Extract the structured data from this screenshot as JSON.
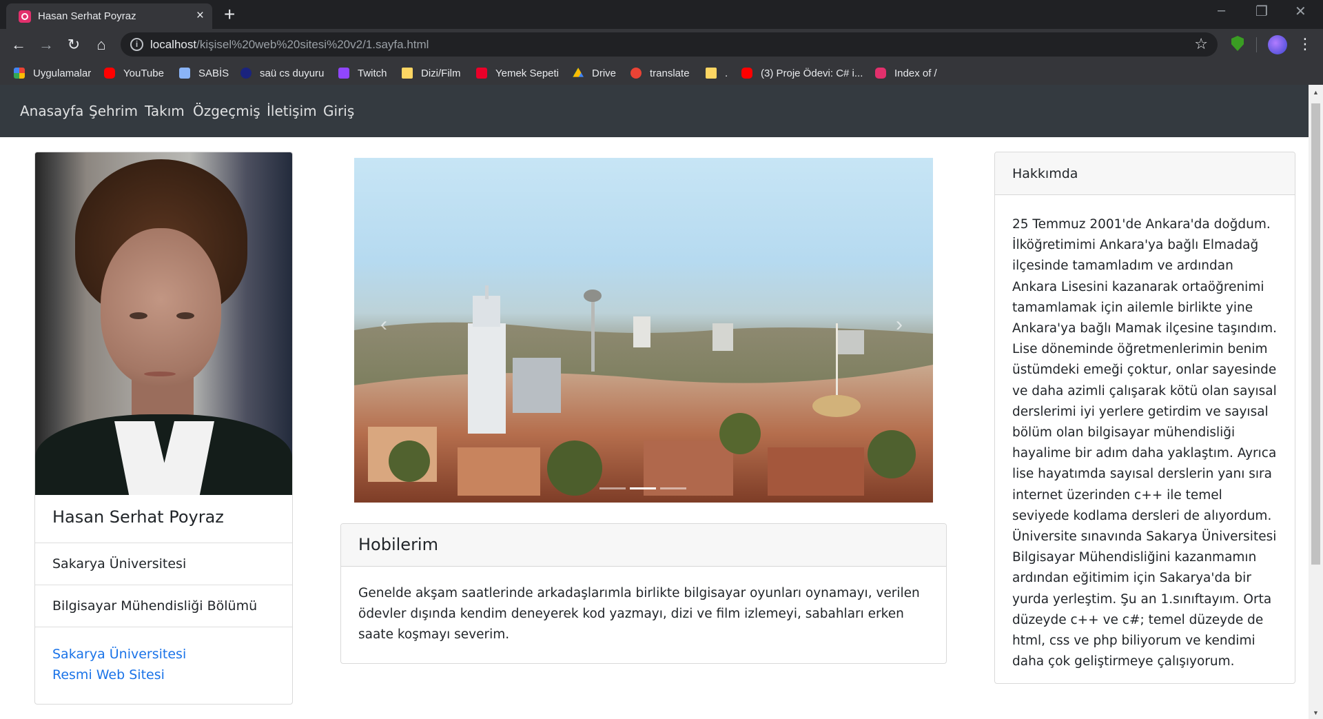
{
  "browser": {
    "tab_title": "Hasan Serhat Poyraz",
    "tab_close": "×",
    "new_tab": "+",
    "url_host": "localhost",
    "url_path": "/kişisel%20web%20sitesi%20v2/1.sayfa.html",
    "window_controls": [
      "–",
      "❐",
      "✕"
    ],
    "icons": [
      "back-icon",
      "forward-icon",
      "reload-icon",
      "home-icon",
      "info-icon",
      "star-icon",
      "shield-extension-icon",
      "profile-avatar",
      "menu-icon"
    ]
  },
  "bookmarks": [
    {
      "label": "Uygulamalar",
      "icon": "apps-icon"
    },
    {
      "label": "YouTube",
      "icon": "youtube-icon"
    },
    {
      "label": "SABİS",
      "icon": "document-icon"
    },
    {
      "label": "saü cs duyuru",
      "icon": "site-icon"
    },
    {
      "label": "Twitch",
      "icon": "twitch-icon"
    },
    {
      "label": "Dizi/Film",
      "icon": "folder-icon"
    },
    {
      "label": "Yemek Sepeti",
      "icon": "yemeksepeti-icon"
    },
    {
      "label": "Drive",
      "icon": "drive-icon"
    },
    {
      "label": "translate",
      "icon": "translate-icon"
    },
    {
      "label": ".",
      "icon": "folder-icon"
    },
    {
      "label": "(3) Proje Ödevi: C# i...",
      "icon": "youtube-icon"
    },
    {
      "label": "Index of /",
      "icon": "index-icon"
    }
  ],
  "nav": {
    "items": [
      "Anasayfa",
      "Şehrim",
      "Takım",
      "Özgeçmiş",
      "İletişim",
      "Giriş"
    ]
  },
  "profile": {
    "name": "Hasan Serhat Poyraz",
    "university": "Sakarya Üniversitesi",
    "department": "Bilgisayar Mühendisliği Bölümü",
    "link_line1": "Sakarya Üniversitesi",
    "link_line2": "Resmi Web Sitesi"
  },
  "carousel": {
    "prev": "‹",
    "next": "›",
    "slide_count": 3,
    "active_slide": 2
  },
  "hobbies": {
    "title": "Hobilerim",
    "text": "Genelde akşam saatlerinde arkadaşlarımla birlikte bilgisayar oyunları oynamayı, verilen ödevler dışında kendim deneyerek kod yazmayı, dizi ve film izlemeyi, sabahları erken saate koşmayı severim."
  },
  "about": {
    "title": "Hakkımda",
    "text": "25 Temmuz 2001'de Ankara'da doğdum. İlköğretimimi Ankara'ya bağlı Elmadağ ilçesinde tamamladım ve ardından Ankara Lisesini kazanarak ortaöğrenimi tamamlamak için ailemle birlikte yine Ankara'ya bağlı Mamak ilçesine taşındım. Lise döneminde öğretmenlerimin benim üstümdeki emeği çoktur, onlar sayesinde ve daha azimli çalışarak kötü olan sayısal derslerimi iyi yerlere getirdim ve sayısal bölüm olan bilgisayar mühendisliği hayalime bir adım daha yaklaştım. Ayrıca lise hayatımda sayısal derslerin yanı sıra internet üzerinden c++ ile temel seviyede kodlama dersleri de alıyordum. Üniversite sınavında Sakarya Üniversitesi Bilgisayar Mühendisliğini kazanmamın ardından eğitimim için Sakarya'da bir yurda yerleştim. Şu an 1.sınıftayım. Orta düzeyde c++ ve c#; temel düzeyde de html, css ve php biliyorum ve kendimi daha çok geliştirmeye çalışıyorum."
  },
  "colors": {
    "navbar_bg": "#343a40",
    "link": "#1a73e8",
    "browser_dark": "#202124",
    "browser_toolbar": "#35363a"
  }
}
